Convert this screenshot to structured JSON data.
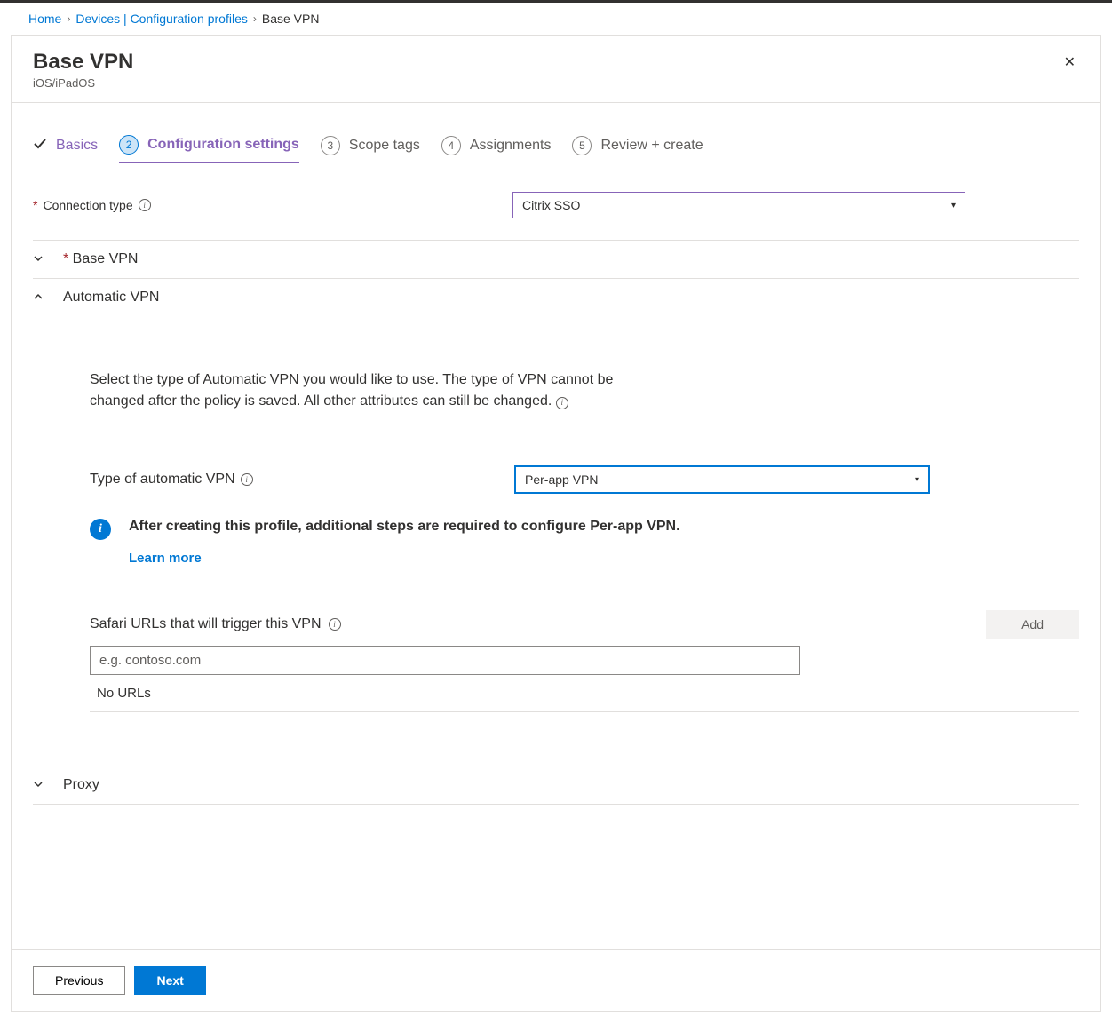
{
  "breadcrumb": {
    "home": "Home",
    "devices": "Devices | Configuration profiles",
    "current": "Base VPN"
  },
  "blade": {
    "title": "Base VPN",
    "subtitle": "iOS/iPadOS"
  },
  "tabs": {
    "basics": "Basics",
    "config_num": "2",
    "config": "Configuration settings",
    "scope_num": "3",
    "scope": "Scope tags",
    "assign_num": "4",
    "assign": "Assignments",
    "review_num": "5",
    "review": "Review + create"
  },
  "connection_type": {
    "label": "Connection type",
    "value": "Citrix SSO"
  },
  "sections": {
    "base_vpn": "Base VPN",
    "automatic_vpn": "Automatic VPN",
    "proxy": "Proxy"
  },
  "automatic": {
    "help_text": "Select the type of Automatic VPN you would like to use. The type of VPN cannot be changed after the policy is saved. All other attributes can still be changed.",
    "type_label": "Type of automatic VPN",
    "type_value": "Per-app VPN",
    "info_text": "After creating this profile, additional steps are required to configure Per-app VPN.",
    "learn_more": "Learn more",
    "safari_label": "Safari URLs that will trigger this VPN",
    "add_label": "Add",
    "url_placeholder": "e.g. contoso.com",
    "no_urls": "No URLs"
  },
  "footer": {
    "previous": "Previous",
    "next": "Next"
  }
}
